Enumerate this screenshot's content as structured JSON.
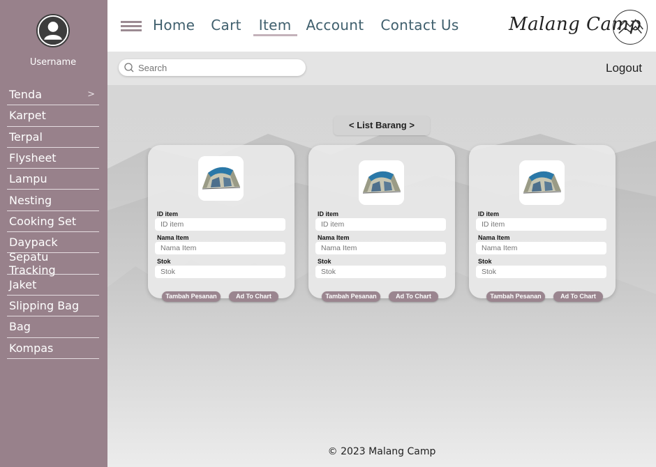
{
  "sidebar": {
    "username": "Username",
    "categories": [
      {
        "label": "Tenda",
        "has_submenu": true
      },
      {
        "label": "Karpet"
      },
      {
        "label": "Terpal"
      },
      {
        "label": "Flysheet"
      },
      {
        "label": "Lampu"
      },
      {
        "label": "Nesting"
      },
      {
        "label": "Cooking Set"
      },
      {
        "label": "Daypack"
      },
      {
        "label": "Sepatu Tracking"
      },
      {
        "label": "Jaket"
      },
      {
        "label": "Slipping Bag"
      },
      {
        "label": "Bag"
      },
      {
        "label": "Kompas"
      }
    ]
  },
  "header": {
    "nav": [
      "Home",
      "Cart",
      "Item",
      "Account",
      "Contact Us"
    ],
    "active_nav": "Item",
    "brand": "Malang Camp"
  },
  "search": {
    "placeholder": "Search"
  },
  "logout_label": "Logout",
  "list_title": "<  List Barang  >",
  "cards": [
    {
      "id_label": "ID item",
      "id_placeholder": "ID item",
      "name_label": "Nama Item",
      "name_placeholder": "Nama Item",
      "stock_label": "Stok",
      "stock_placeholder": "Stok",
      "order_button": "Tambah Pesanan",
      "cart_button": "Ad To Chart"
    },
    {
      "id_label": "ID item",
      "id_placeholder": "ID item",
      "name_label": "Nama Item",
      "name_placeholder": "Nama Item",
      "stock_label": "Stok",
      "stock_placeholder": "Stok",
      "order_button": "Tambah Pesanan",
      "cart_button": "Ad To Chart"
    },
    {
      "id_label": "ID item",
      "id_placeholder": "ID item",
      "name_label": "Nama Item",
      "name_placeholder": "Nama Item",
      "stock_label": "Stok",
      "stock_placeholder": "Stok",
      "order_button": "Tambah Pesanan",
      "cart_button": "Ad To Chart"
    }
  ],
  "footer": "© 2023 Malang Camp",
  "colors": {
    "sidebar": "#98818b",
    "nav_text": "#3f5f6d",
    "button": "#9a858f"
  },
  "icons": {
    "avatar": "user-avatar-icon",
    "menu": "hamburger-icon",
    "search": "search-icon",
    "logo": "mountain-logo-icon",
    "chevron": "chevron-right-icon",
    "item_image": "tent-icon"
  }
}
